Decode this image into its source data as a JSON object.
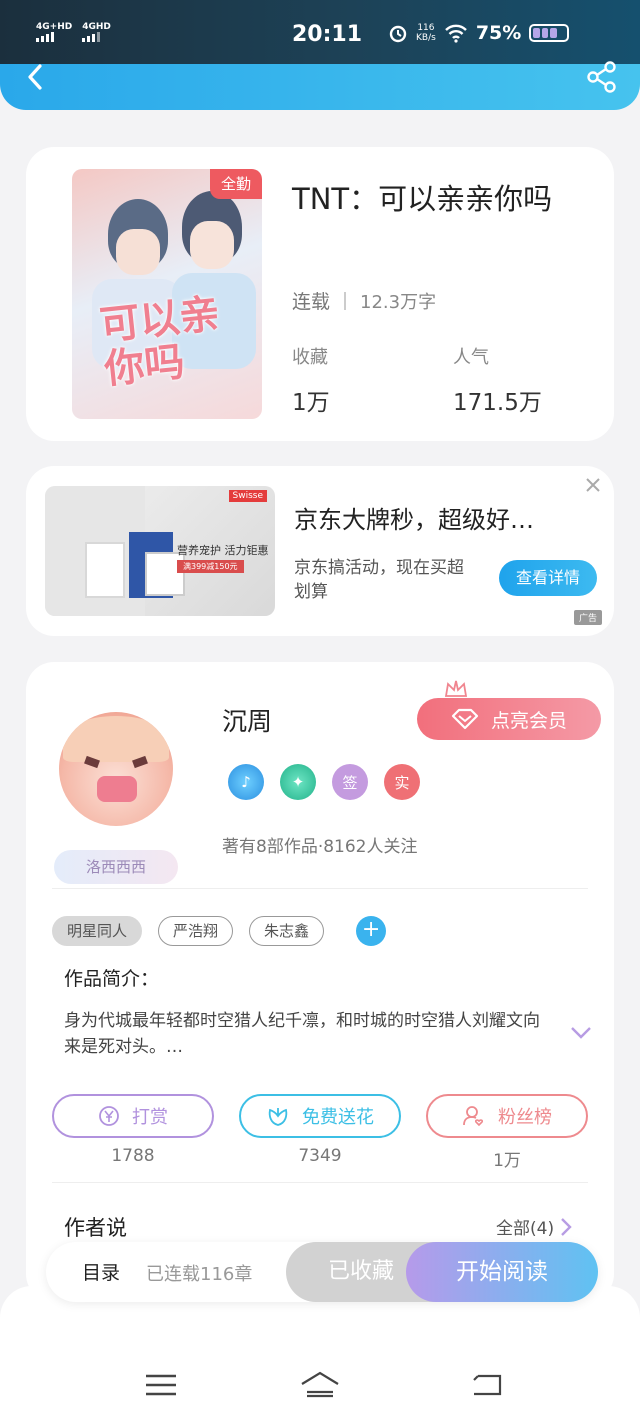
{
  "status_bar": {
    "signal1": "4G+HD",
    "signal2": "4GHD",
    "time": "20:11",
    "speed_value": "116",
    "speed_unit": "KB/s",
    "battery": "75%"
  },
  "book": {
    "cover_badge": "全勤",
    "title": "TNT：可以亲亲你吗",
    "status": "连载",
    "word_count": "12.3万字",
    "favorites_label": "收藏",
    "favorites_value": "1万",
    "popularity_label": "人气",
    "popularity_value": "171.5万"
  },
  "ad": {
    "title": "京东大牌秒，超级好…",
    "description": "京东搞活动，现在买超划算",
    "button": "查看详情",
    "tag": "广告",
    "image_brand": "Swisse",
    "image_slogan": "营养宠护 活力钜惠",
    "image_price": "满399减150元"
  },
  "author": {
    "name": "沉周",
    "vip_button": "点亮会员",
    "fan_name": "洛西西西",
    "badge_sign": "签",
    "badge_real": "实",
    "works_line": "著有8部作品·8162人关注"
  },
  "tags": [
    "明星同人",
    "严浩翔",
    "朱志鑫"
  ],
  "intro": {
    "label": "作品简介：",
    "text": "身为代城最年轻都时空猎人纪千凛，和时城的时空猎人刘耀文向来是死对头。…"
  },
  "actions": [
    {
      "label": "打赏",
      "count": "1788",
      "color": "#b192de"
    },
    {
      "label": "免费送花",
      "count": "7349",
      "color": "#3cbfe5"
    },
    {
      "label": "粉丝榜",
      "count": "1万",
      "color": "#ee8a8e"
    }
  ],
  "author_says": {
    "label": "作者说",
    "all_link": "全部(4)"
  },
  "bottom_bar": {
    "toc": "目录",
    "serial": "已连载116章",
    "collected": "已收藏",
    "start_reading": "开始阅读"
  },
  "colors": {
    "accent_blue": "#2aa8ea",
    "vip_pink": "#f26f7c",
    "read_gradient_start": "#b69aea",
    "read_gradient_end": "#5fc2f2"
  }
}
